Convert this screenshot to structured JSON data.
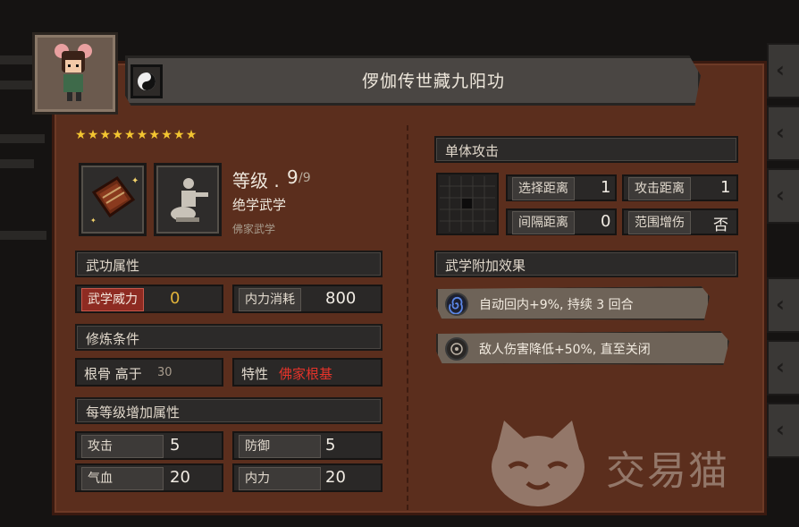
{
  "skill": {
    "title": "㑩伽传世藏九阳功",
    "stars": "★★★★★★★★★★",
    "level_label": "等级 .",
    "level": "9",
    "level_max": "/9",
    "rank": "绝学武学",
    "school": "佛家武学"
  },
  "attributes": {
    "header": "武功属性",
    "power_label": "武学威力",
    "power_value": "0",
    "cost_label": "内力消耗",
    "cost_value": "800"
  },
  "requirements": {
    "header": "修炼条件",
    "bone_label": "根骨 高于",
    "bone_value": "30",
    "trait_label": "特性",
    "trait_value": "佛家根基"
  },
  "per_level": {
    "header": "每等级增加属性",
    "attack_label": "攻击",
    "attack_value": "5",
    "defense_label": "防御",
    "defense_value": "5",
    "hp_label": "气血",
    "hp_value": "20",
    "mp_label": "内力",
    "mp_value": "20"
  },
  "targeting": {
    "header": "单体攻击",
    "select_range_label": "选择距离",
    "select_range_value": "1",
    "attack_range_label": "攻击距离",
    "attack_range_value": "1",
    "interval_label": "间隔距离",
    "interval_value": "0",
    "aoe_label": "范围增伤",
    "aoe_value": "否"
  },
  "effects": {
    "header": "武学附加效果",
    "items": [
      {
        "text": "自动回内+9%, 持续 3 回合",
        "icon": "spiral-icon"
      },
      {
        "text": "敌人伤害降低+50%, 直至关闭",
        "icon": "target-icon"
      }
    ]
  },
  "watermark": {
    "text": "交易猫"
  },
  "colors": {
    "panel": "#5b2e1d",
    "star": "#f3c531",
    "trait": "#e5332a",
    "power_value": "#e2b43a",
    "highlight": "#8e2b22"
  }
}
